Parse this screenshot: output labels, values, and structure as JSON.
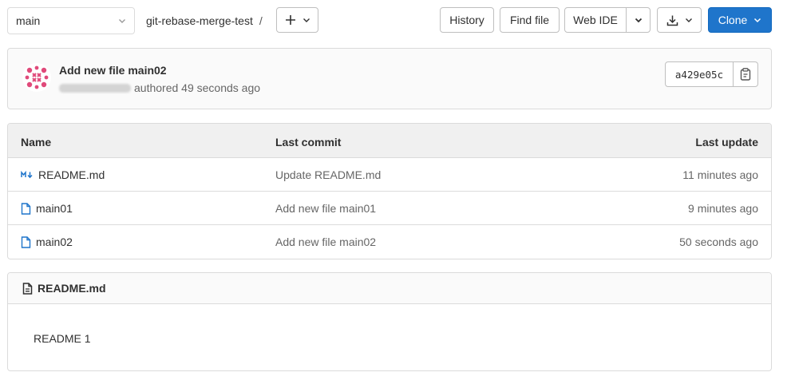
{
  "topbar": {
    "branch": "main",
    "project": "git-rebase-merge-test",
    "separator": "/",
    "add_icon": "plus-icon"
  },
  "actions": {
    "history": "History",
    "find_file": "Find file",
    "web_ide": "Web IDE",
    "clone": "Clone"
  },
  "commit": {
    "title": "Add new file main02",
    "meta": "authored 49 seconds ago",
    "sha": "a429e05c"
  },
  "table": {
    "headers": {
      "name": "Name",
      "last_commit": "Last commit",
      "last_update": "Last update"
    },
    "rows": [
      {
        "name": "README.md",
        "icon": "markdown-icon",
        "commit": "Update README.md",
        "updated": "11 minutes ago"
      },
      {
        "name": "main01",
        "icon": "file-icon",
        "commit": "Add new file main01",
        "updated": "9 minutes ago"
      },
      {
        "name": "main02",
        "icon": "file-icon",
        "commit": "Add new file main02",
        "updated": "50 seconds ago"
      }
    ]
  },
  "readme": {
    "filename": "README.md",
    "content": "README 1"
  },
  "colors": {
    "primary": "#1f75cb",
    "border": "#dbdbdb",
    "icon_blue": "#1f75cb"
  }
}
